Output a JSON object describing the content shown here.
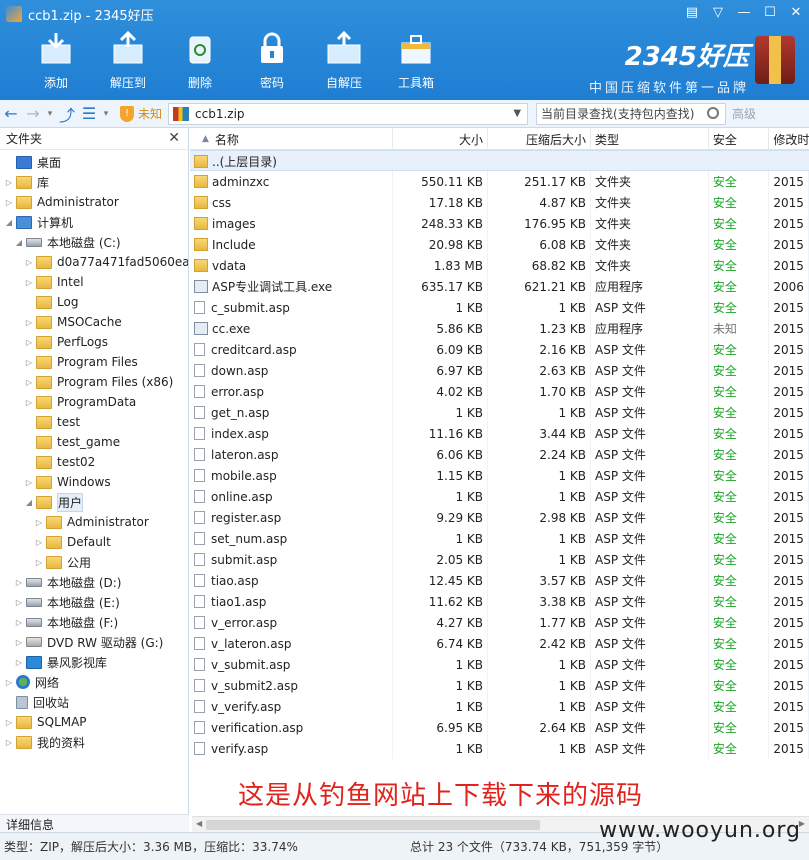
{
  "window": {
    "title": "ccb1.zip - 2345好压"
  },
  "toolbar": [
    {
      "label": "添加",
      "icon": "add-icon"
    },
    {
      "label": "解压到",
      "icon": "extract-icon"
    },
    {
      "label": "删除",
      "icon": "delete-icon"
    },
    {
      "label": "密码",
      "icon": "lock-icon"
    },
    {
      "label": "自解压",
      "icon": "self-extract-icon"
    },
    {
      "label": "工具箱",
      "icon": "toolbox-icon"
    }
  ],
  "brand": {
    "name": "2345好压",
    "slogan": "中国压缩软件第一品牌"
  },
  "address": {
    "security": "未知",
    "path": "ccb1.zip",
    "search_placeholder": "当前目录查找(支持包内查找)",
    "advanced": "高级"
  },
  "left_pane": {
    "title": "文件夹",
    "tree": [
      {
        "label": "桌面",
        "indent": 0,
        "icon": "desktop",
        "twisty": ""
      },
      {
        "label": "库",
        "indent": 0,
        "icon": "folder",
        "twisty": "▷"
      },
      {
        "label": "Administrator",
        "indent": 0,
        "icon": "folder",
        "twisty": "▷"
      },
      {
        "label": "计算机",
        "indent": 0,
        "icon": "pc",
        "twisty": "◢"
      },
      {
        "label": "本地磁盘 (C:)",
        "indent": 1,
        "icon": "drive",
        "twisty": "◢"
      },
      {
        "label": "d0a77a471fad5060ea",
        "indent": 2,
        "icon": "folder",
        "twisty": "▷"
      },
      {
        "label": "Intel",
        "indent": 2,
        "icon": "folder",
        "twisty": "▷"
      },
      {
        "label": "Log",
        "indent": 2,
        "icon": "folder",
        "twisty": ""
      },
      {
        "label": "MSOCache",
        "indent": 2,
        "icon": "folder",
        "twisty": "▷"
      },
      {
        "label": "PerfLogs",
        "indent": 2,
        "icon": "folder",
        "twisty": "▷"
      },
      {
        "label": "Program Files",
        "indent": 2,
        "icon": "folder",
        "twisty": "▷"
      },
      {
        "label": "Program Files (x86)",
        "indent": 2,
        "icon": "folder",
        "twisty": "▷"
      },
      {
        "label": "ProgramData",
        "indent": 2,
        "icon": "folder",
        "twisty": "▷"
      },
      {
        "label": "test",
        "indent": 2,
        "icon": "folder",
        "twisty": ""
      },
      {
        "label": "test_game",
        "indent": 2,
        "icon": "folder",
        "twisty": ""
      },
      {
        "label": "test02",
        "indent": 2,
        "icon": "folder",
        "twisty": ""
      },
      {
        "label": "Windows",
        "indent": 2,
        "icon": "folder",
        "twisty": "▷"
      },
      {
        "label": "用户",
        "indent": 2,
        "icon": "folder",
        "twisty": "◢",
        "selected": true
      },
      {
        "label": "Administrator",
        "indent": 3,
        "icon": "folder",
        "twisty": "▷"
      },
      {
        "label": "Default",
        "indent": 3,
        "icon": "folder",
        "twisty": "▷"
      },
      {
        "label": "公用",
        "indent": 3,
        "icon": "folder",
        "twisty": "▷"
      },
      {
        "label": "本地磁盘 (D:)",
        "indent": 1,
        "icon": "drive",
        "twisty": "▷"
      },
      {
        "label": "本地磁盘 (E:)",
        "indent": 1,
        "icon": "drive",
        "twisty": "▷"
      },
      {
        "label": "本地磁盘 (F:)",
        "indent": 1,
        "icon": "drive",
        "twisty": "▷"
      },
      {
        "label": "DVD RW 驱动器 (G:)",
        "indent": 1,
        "icon": "dvd",
        "twisty": "▷"
      },
      {
        "label": "暴风影视库",
        "indent": 1,
        "icon": "media",
        "twisty": "▷"
      },
      {
        "label": "网络",
        "indent": 0,
        "icon": "net",
        "twisty": "▷"
      },
      {
        "label": "回收站",
        "indent": 0,
        "icon": "bin",
        "twisty": ""
      },
      {
        "label": "SQLMAP",
        "indent": 0,
        "icon": "folder",
        "twisty": "▷"
      },
      {
        "label": "我的资料",
        "indent": 0,
        "icon": "folder",
        "twisty": "▷"
      }
    ],
    "detail_title": "详细信息"
  },
  "columns": {
    "name": "名称",
    "size": "大小",
    "packed": "压缩后大小",
    "type": "类型",
    "security": "安全",
    "modified": "修改时"
  },
  "parent_dir": "..(上层目录)",
  "files": [
    {
      "name": "adminzxc",
      "size": "550.11 KB",
      "packed": "251.17 KB",
      "type": "文件夹",
      "security": "安全",
      "modified": "2015",
      "kind": "folder"
    },
    {
      "name": "css",
      "size": "17.18 KB",
      "packed": "4.87 KB",
      "type": "文件夹",
      "security": "安全",
      "modified": "2015",
      "kind": "folder"
    },
    {
      "name": "images",
      "size": "248.33 KB",
      "packed": "176.95 KB",
      "type": "文件夹",
      "security": "安全",
      "modified": "2015",
      "kind": "folder"
    },
    {
      "name": "Include",
      "size": "20.98 KB",
      "packed": "6.08 KB",
      "type": "文件夹",
      "security": "安全",
      "modified": "2015",
      "kind": "folder"
    },
    {
      "name": "vdata",
      "size": "1.83 MB",
      "packed": "68.82 KB",
      "type": "文件夹",
      "security": "安全",
      "modified": "2015",
      "kind": "folder"
    },
    {
      "name": "ASP专业调试工具.exe",
      "size": "635.17 KB",
      "packed": "621.21 KB",
      "type": "应用程序",
      "security": "安全",
      "modified": "2006",
      "kind": "exe"
    },
    {
      "name": "c_submit.asp",
      "size": "1 KB",
      "packed": "1 KB",
      "type": "ASP 文件",
      "security": "安全",
      "modified": "2015",
      "kind": "file"
    },
    {
      "name": "cc.exe",
      "size": "5.86 KB",
      "packed": "1.23 KB",
      "type": "应用程序",
      "security": "未知",
      "modified": "2015",
      "kind": "exe"
    },
    {
      "name": "creditcard.asp",
      "size": "6.09 KB",
      "packed": "2.16 KB",
      "type": "ASP 文件",
      "security": "安全",
      "modified": "2015",
      "kind": "file"
    },
    {
      "name": "down.asp",
      "size": "6.97 KB",
      "packed": "2.63 KB",
      "type": "ASP 文件",
      "security": "安全",
      "modified": "2015",
      "kind": "file"
    },
    {
      "name": "error.asp",
      "size": "4.02 KB",
      "packed": "1.70 KB",
      "type": "ASP 文件",
      "security": "安全",
      "modified": "2015",
      "kind": "file"
    },
    {
      "name": "get_n.asp",
      "size": "1 KB",
      "packed": "1 KB",
      "type": "ASP 文件",
      "security": "安全",
      "modified": "2015",
      "kind": "file"
    },
    {
      "name": "index.asp",
      "size": "11.16 KB",
      "packed": "3.44 KB",
      "type": "ASP 文件",
      "security": "安全",
      "modified": "2015",
      "kind": "file"
    },
    {
      "name": "lateron.asp",
      "size": "6.06 KB",
      "packed": "2.24 KB",
      "type": "ASP 文件",
      "security": "安全",
      "modified": "2015",
      "kind": "file"
    },
    {
      "name": "mobile.asp",
      "size": "1.15 KB",
      "packed": "1 KB",
      "type": "ASP 文件",
      "security": "安全",
      "modified": "2015",
      "kind": "file"
    },
    {
      "name": "online.asp",
      "size": "1 KB",
      "packed": "1 KB",
      "type": "ASP 文件",
      "security": "安全",
      "modified": "2015",
      "kind": "file"
    },
    {
      "name": "register.asp",
      "size": "9.29 KB",
      "packed": "2.98 KB",
      "type": "ASP 文件",
      "security": "安全",
      "modified": "2015",
      "kind": "file"
    },
    {
      "name": "set_num.asp",
      "size": "1 KB",
      "packed": "1 KB",
      "type": "ASP 文件",
      "security": "安全",
      "modified": "2015",
      "kind": "file"
    },
    {
      "name": "submit.asp",
      "size": "2.05 KB",
      "packed": "1 KB",
      "type": "ASP 文件",
      "security": "安全",
      "modified": "2015",
      "kind": "file"
    },
    {
      "name": "tiao.asp",
      "size": "12.45 KB",
      "packed": "3.57 KB",
      "type": "ASP 文件",
      "security": "安全",
      "modified": "2015",
      "kind": "file"
    },
    {
      "name": "tiao1.asp",
      "size": "11.62 KB",
      "packed": "3.38 KB",
      "type": "ASP 文件",
      "security": "安全",
      "modified": "2015",
      "kind": "file"
    },
    {
      "name": "v_error.asp",
      "size": "4.27 KB",
      "packed": "1.77 KB",
      "type": "ASP 文件",
      "security": "安全",
      "modified": "2015",
      "kind": "file"
    },
    {
      "name": "v_lateron.asp",
      "size": "6.74 KB",
      "packed": "2.42 KB",
      "type": "ASP 文件",
      "security": "安全",
      "modified": "2015",
      "kind": "file"
    },
    {
      "name": "v_submit.asp",
      "size": "1 KB",
      "packed": "1 KB",
      "type": "ASP 文件",
      "security": "安全",
      "modified": "2015",
      "kind": "file"
    },
    {
      "name": "v_submit2.asp",
      "size": "1 KB",
      "packed": "1 KB",
      "type": "ASP 文件",
      "security": "安全",
      "modified": "2015",
      "kind": "file"
    },
    {
      "name": "v_verify.asp",
      "size": "1 KB",
      "packed": "1 KB",
      "type": "ASP 文件",
      "security": "安全",
      "modified": "2015",
      "kind": "file"
    },
    {
      "name": "verification.asp",
      "size": "6.95 KB",
      "packed": "2.64 KB",
      "type": "ASP 文件",
      "security": "安全",
      "modified": "2015",
      "kind": "file"
    },
    {
      "name": "verify.asp",
      "size": "1 KB",
      "packed": "1 KB",
      "type": "ASP 文件",
      "security": "安全",
      "modified": "2015",
      "kind": "file"
    }
  ],
  "caption": "这是从钓鱼网站上下载下来的源码",
  "status": {
    "left": "类型：ZIP，解压后大小：3.36 MB，压缩比：33.74%",
    "right": "总计 23 个文件（733.74 KB，751,359 字节）"
  },
  "watermark": "www.wooyun.org",
  "colors": {
    "accent": "#2385d6",
    "safe": "#1aa526",
    "caption": "#e0231c"
  }
}
